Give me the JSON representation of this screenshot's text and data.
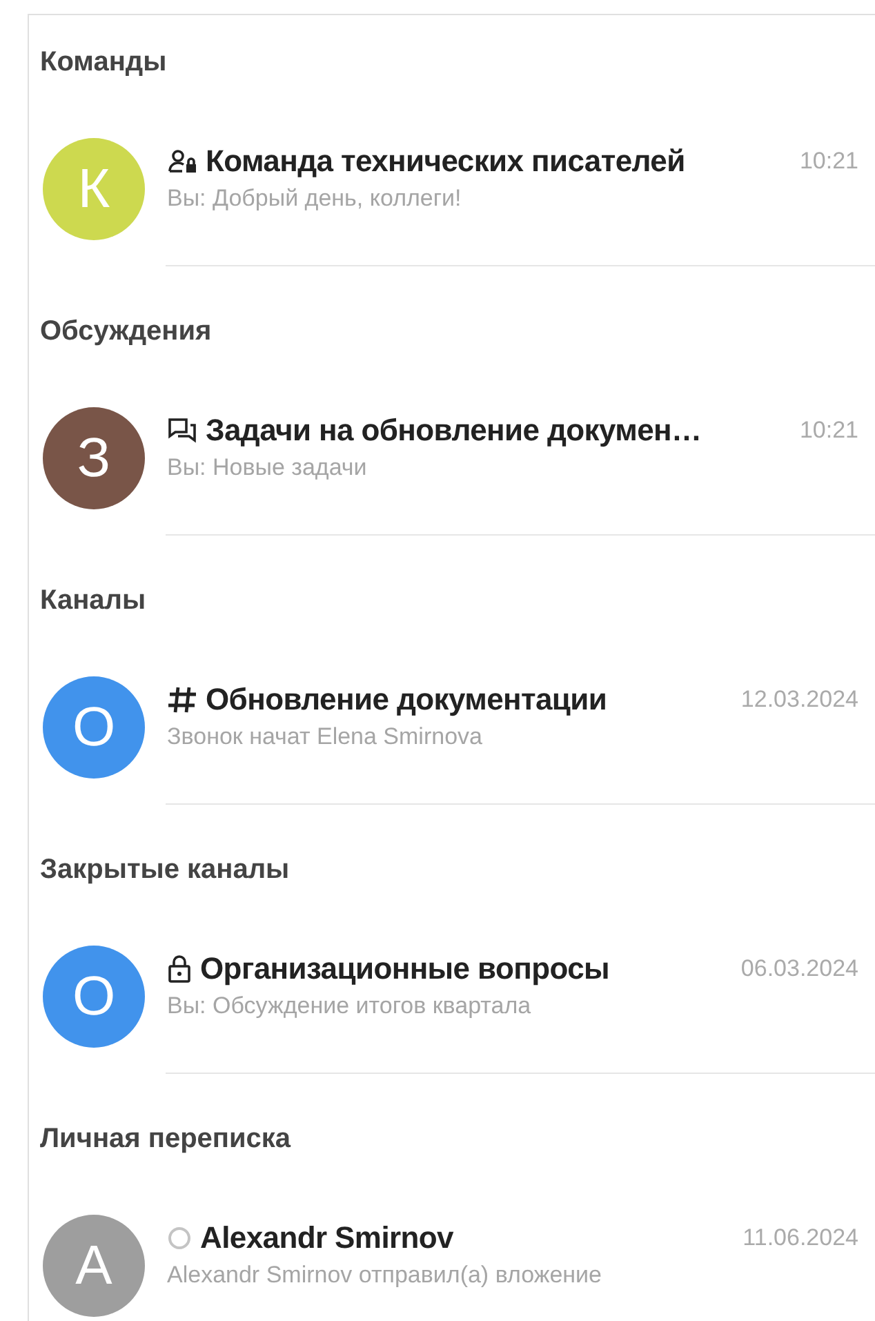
{
  "sections": [
    {
      "title": "Команды",
      "chats": [
        {
          "kind": "team",
          "avatar": "К",
          "color": "#cdd94f",
          "name": "Команда технических писателей",
          "time": "10:21",
          "preview": "Вы: Добрый день, коллеги!"
        }
      ]
    },
    {
      "title": "Обсуждения",
      "chats": [
        {
          "kind": "discussion",
          "avatar": "З",
          "color": "#795548",
          "name": "Задачи на обновление докумен…",
          "time": "10:21",
          "preview": "Вы: Новые задачи"
        }
      ]
    },
    {
      "title": "Каналы",
      "chats": [
        {
          "kind": "channel",
          "avatar": "О",
          "color": "#4193ec",
          "name": "Обновление документации",
          "time": "12.03.2024",
          "preview": "Звонок начат Elena Smirnova"
        }
      ]
    },
    {
      "title": "Закрытые каналы",
      "chats": [
        {
          "kind": "private",
          "avatar": "О",
          "color": "#4193ec",
          "name": "Организационные вопросы",
          "time": "06.03.2024",
          "preview": "Вы: Обсуждение итогов квартала"
        }
      ]
    },
    {
      "title": "Личная переписка",
      "chats": [
        {
          "kind": "direct",
          "avatar": "А",
          "color": "#9e9e9e",
          "name": "Alexandr Smirnov",
          "time": "11.06.2024",
          "preview": "Alexandr Smirnov отправил(а) вложение"
        }
      ]
    }
  ]
}
